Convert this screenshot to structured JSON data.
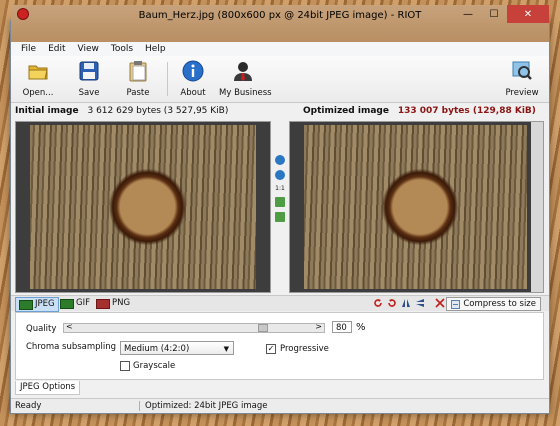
{
  "window": {
    "title": "Baum_Herz.jpg (800x600 px @ 24bit JPEG image) - RIOT",
    "controls": {
      "minimize": "—",
      "maximize": "☐",
      "close": "✕"
    }
  },
  "menu": [
    "File",
    "Edit",
    "View",
    "Tools",
    "Help"
  ],
  "toolbar": {
    "open": "Open...",
    "save": "Save",
    "paste": "Paste",
    "about": "About",
    "business": "My Business",
    "preview": "Preview"
  },
  "initial": {
    "label": "Initial image",
    "size": "3 612 629 bytes (3 527,95 KiB)"
  },
  "optimized": {
    "label": "Optimized image",
    "size": "133 007 bytes (129,88 KiB)"
  },
  "zoom": {
    "one_to_one": "1:1"
  },
  "formats": {
    "jpeg": "JPEG",
    "gif": "GIF",
    "png": "PNG",
    "selected": "JPEG"
  },
  "compress_button": "Compress to size",
  "options": {
    "quality_label": "Quality",
    "quality_value": "80",
    "quality_unit": "%",
    "quality_fraction": 0.8,
    "chroma_label": "Chroma subsampling",
    "chroma_value": "Medium (4:2:0)",
    "progressive_label": "Progressive",
    "progressive_checked": true,
    "grayscale_label": "Grayscale",
    "grayscale_checked": false
  },
  "options_tab": "JPEG Options",
  "status": {
    "left": "Ready",
    "right": "Optimized: 24bit JPEG image"
  },
  "colors": {
    "accent_red": "#8b1414",
    "selected_tab": "#c9dff6"
  },
  "icons": {
    "open": "folder-icon",
    "save": "floppy-disk-icon",
    "paste": "clipboard-icon",
    "about": "info-icon",
    "business": "business-person-icon",
    "preview": "magnifier-icon"
  }
}
